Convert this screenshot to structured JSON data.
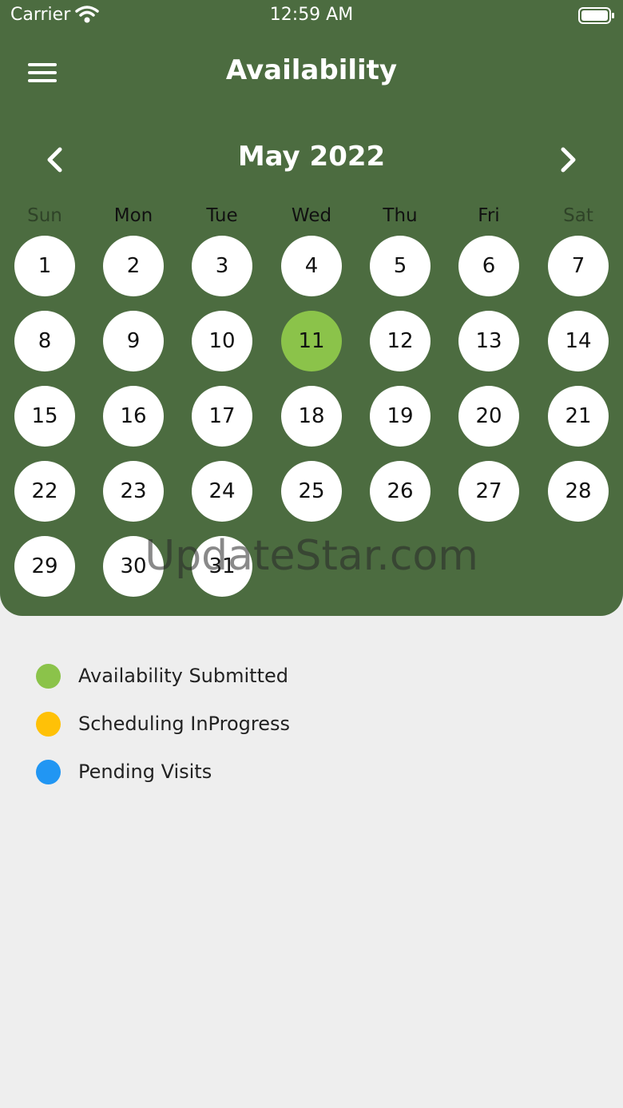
{
  "status_bar": {
    "carrier": "Carrier",
    "time": "12:59 AM"
  },
  "header": {
    "title": "Availability"
  },
  "calendar": {
    "month_label": "May 2022",
    "weekdays": [
      "Sun",
      "Mon",
      "Tue",
      "Wed",
      "Thu",
      "Fri",
      "Sat"
    ],
    "days": [
      "1",
      "2",
      "3",
      "4",
      "5",
      "6",
      "7",
      "8",
      "9",
      "10",
      "11",
      "12",
      "13",
      "14",
      "15",
      "16",
      "17",
      "18",
      "19",
      "20",
      "21",
      "22",
      "23",
      "24",
      "25",
      "26",
      "27",
      "28",
      "29",
      "30",
      "31"
    ],
    "selected_day": "11"
  },
  "legend": [
    {
      "label": "Availability Submitted",
      "color": "#8bc34a"
    },
    {
      "label": "Scheduling InProgress",
      "color": "#ffc107"
    },
    {
      "label": "Pending Visits",
      "color": "#2196f3"
    }
  ],
  "watermark": "UpdateStar.com",
  "colors": {
    "header_bg": "#4c6c40",
    "selected_day": "#8bc34a",
    "page_bg": "#eeeeee"
  }
}
